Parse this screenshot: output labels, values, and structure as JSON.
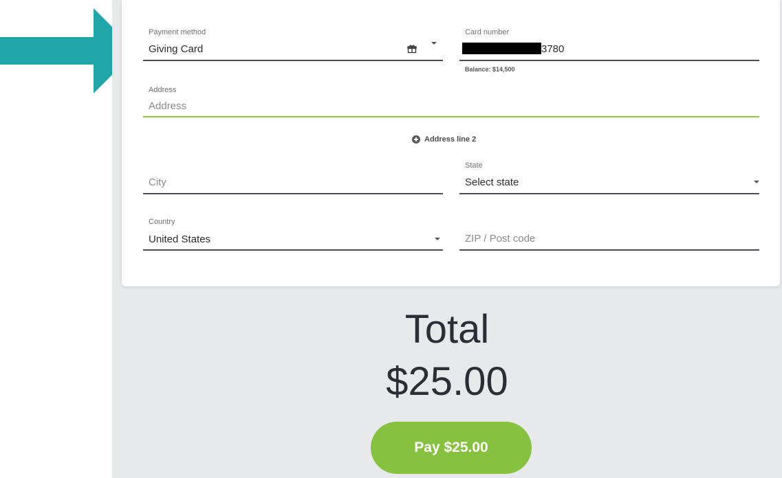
{
  "colors": {
    "arrow": "#20a6a8",
    "accent_green": "#86c13f",
    "active_underline": "#8dc63f",
    "page_gray": "#e8e9eb"
  },
  "payment_method": {
    "label": "Payment method",
    "value": "Giving Card",
    "icon": "gift-icon"
  },
  "card_number": {
    "label": "Card number",
    "value_suffix": "3780",
    "balance": "Balance: $14,500"
  },
  "address": {
    "label": "Address",
    "placeholder": "Address"
  },
  "address_line2": {
    "label": "Address line 2",
    "icon": "plus-circle-icon"
  },
  "city": {
    "placeholder": "City"
  },
  "state": {
    "label": "State",
    "value": "Select state"
  },
  "country": {
    "label": "Country",
    "value": "United States"
  },
  "zip": {
    "placeholder": "ZIP / Post code"
  },
  "total": {
    "label": "Total",
    "amount": "$25.00"
  },
  "pay_button": {
    "label": "Pay $25.00"
  }
}
